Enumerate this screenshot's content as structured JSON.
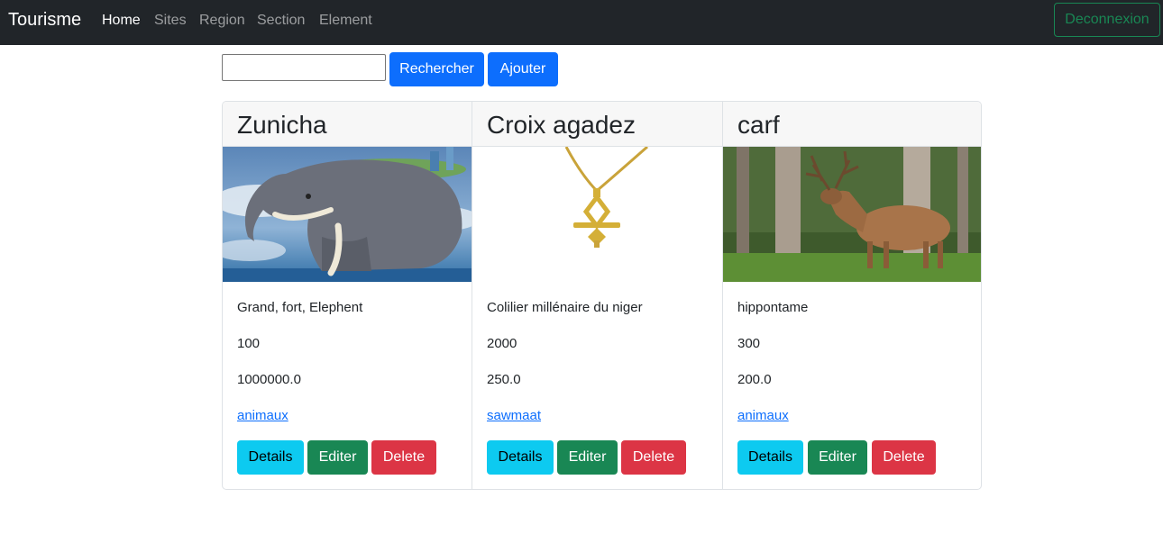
{
  "navbar": {
    "brand": "Tourisme",
    "links": [
      "Home",
      "Sites",
      "Region",
      "Section",
      "Element"
    ],
    "logout_label": "Deconnexion"
  },
  "search": {
    "value": "",
    "search_label": "Rechercher",
    "add_label": "Ajouter"
  },
  "buttons": {
    "details": "Details",
    "edit": "Editer",
    "delete": "Delete"
  },
  "cards": [
    {
      "title": "Zunicha",
      "image": "elephant-image",
      "description": "Grand, fort, Elephent",
      "value1": "100",
      "value2": "1000000.0",
      "link": "animaux"
    },
    {
      "title": "Croix agadez",
      "image": "necklace-image",
      "description": "Colilier millénaire du niger",
      "value1": "2000",
      "value2": "250.0",
      "link": "sawmaat"
    },
    {
      "title": "carf",
      "image": "deer-image",
      "description": "hippontame",
      "value1": "300",
      "value2": "200.0",
      "link": "animaux"
    }
  ]
}
